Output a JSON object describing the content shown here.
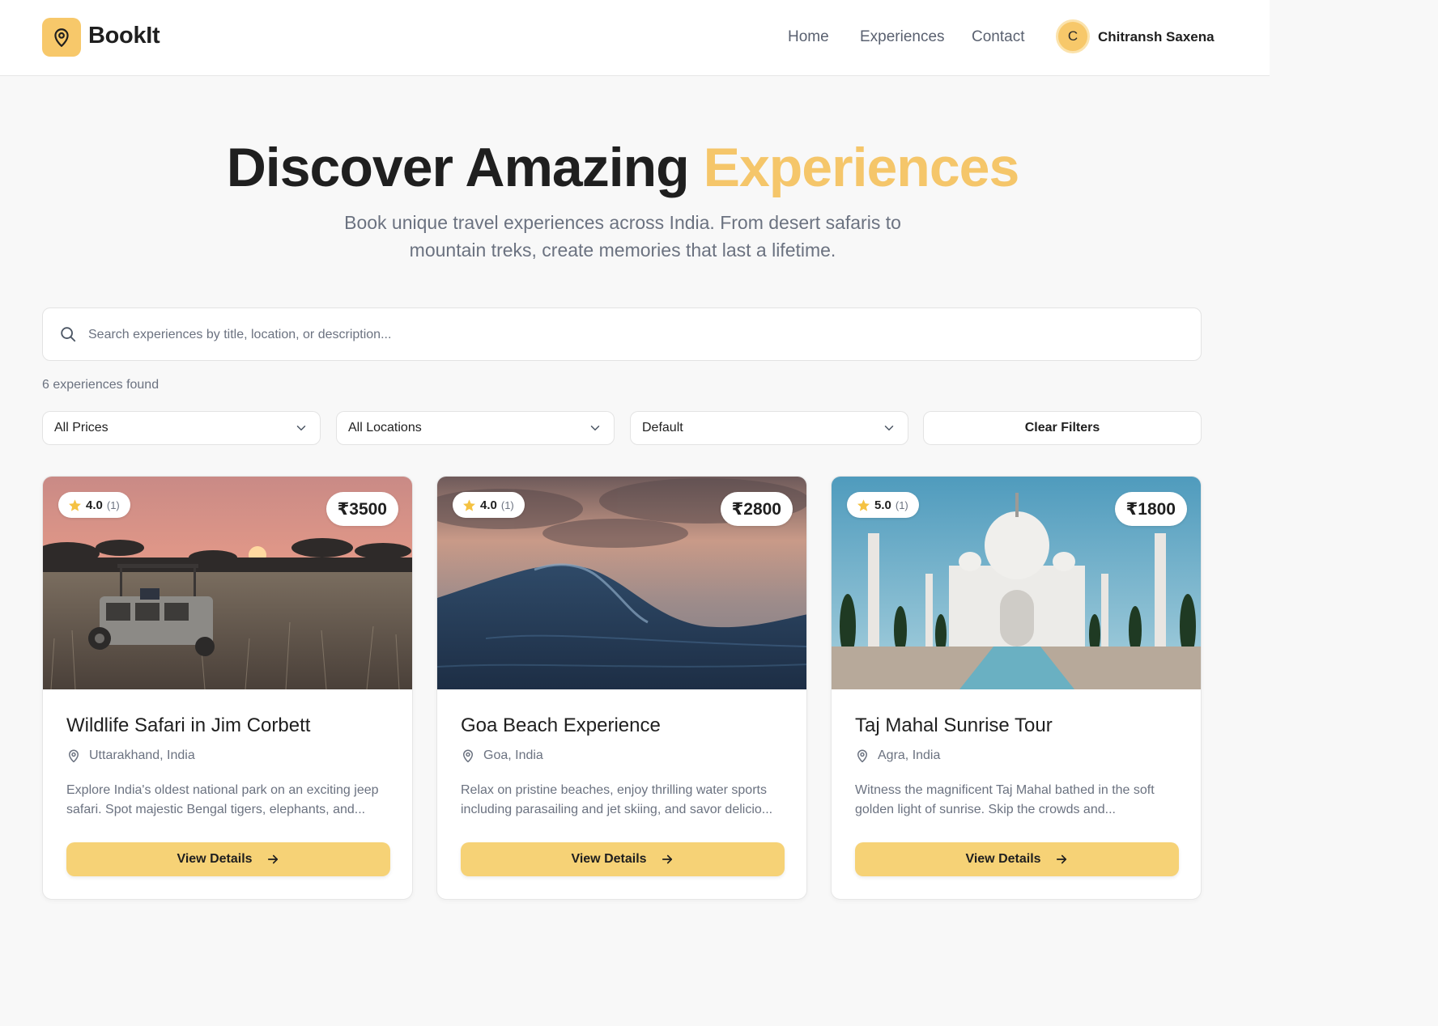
{
  "header": {
    "logo_text": "BookIt",
    "nav": [
      "Home",
      "Experiences",
      "Contact"
    ],
    "avatar_initial": "C",
    "username": "Chitransh Saxena"
  },
  "hero": {
    "title_main": "Discover Amazing ",
    "title_accent": "Experiences",
    "subtitle": "Book unique travel experiences across India. From desert safaris to mountain treks, create memories that last a lifetime."
  },
  "search": {
    "placeholder": "Search experiences by title, location, or description...",
    "value": ""
  },
  "results_count": "6 experiences found",
  "filters": {
    "price": "All Prices",
    "location": "All Locations",
    "sort": "Default",
    "clear_label": "Clear Filters"
  },
  "colors": {
    "accent": "#f5c66a",
    "button": "#f6d276",
    "text": "#1f1f1f",
    "muted": "#6b7280"
  },
  "cards": [
    {
      "rating": "4.0",
      "rating_count": "(1)",
      "price": "₹3500",
      "title": "Wildlife Safari in Jim Corbett",
      "location": "Uttarakhand, India",
      "description": "Explore India's oldest national park on an exciting jeep safari. Spot majestic Bengal tigers, elephants, and...",
      "button": "View Details",
      "image_icon": "safari-jeep-sunset-image"
    },
    {
      "rating": "4.0",
      "rating_count": "(1)",
      "price": "₹2800",
      "title": "Goa Beach Experience",
      "location": "Goa, India",
      "description": "Relax on pristine beaches, enjoy thrilling water sports including parasailing and jet skiing, and savor delicio...",
      "button": "View Details",
      "image_icon": "ocean-wave-image"
    },
    {
      "rating": "5.0",
      "rating_count": "(1)",
      "price": "₹1800",
      "title": "Taj Mahal Sunrise Tour",
      "location": "Agra, India",
      "description": "Witness the magnificent Taj Mahal bathed in the soft golden light of sunrise. Skip the crowds and...",
      "button": "View Details",
      "image_icon": "taj-mahal-image"
    }
  ]
}
